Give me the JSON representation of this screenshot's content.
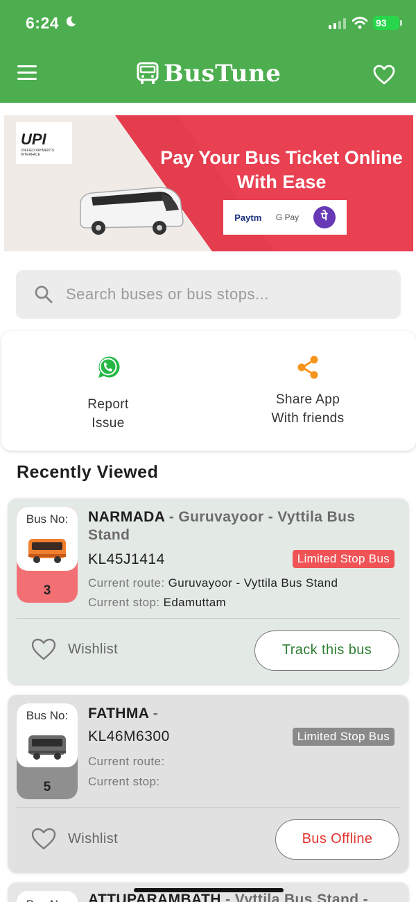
{
  "status_bar": {
    "time": "6:24",
    "battery": "93"
  },
  "header": {
    "title": "BusTune",
    "menu_icon": "hamburger-menu-icon",
    "favorites_icon": "heart-outline-icon"
  },
  "banner": {
    "upi_logo": "UPI",
    "upi_tagline": "UNIFIED PAYMENTS INTERFACE",
    "heading_line1": "Pay Your Bus Ticket Online",
    "heading_line2": "With Ease",
    "payment_apps": [
      "Paytm",
      "G Pay",
      "पे"
    ]
  },
  "search": {
    "placeholder": "Search buses or bus stops..."
  },
  "actions": {
    "report_line1": "Report",
    "report_line2": "Issue",
    "share_line1": "Share App",
    "share_line2": "With friends"
  },
  "recently_viewed": {
    "title": "Recently Viewed",
    "busno_label": "Bus No:",
    "route_label": "Current route:",
    "stop_label": "Current stop:",
    "wishlist_label": "Wishlist",
    "buses": [
      {
        "number": "3",
        "name": "NARMADA",
        "route_suffix": " - Guruvayoor - Vyttila Bus Stand",
        "registration": "KL45J1414",
        "type": "Limited Stop Bus",
        "current_route": "Guruvayoor - Vyttila Bus Stand",
        "current_stop": "Edamuttam",
        "button": "Track this bus",
        "accent_color": "#f27074"
      },
      {
        "number": "5",
        "name": "FATHMA",
        "route_suffix": " -",
        "registration": "KL46M6300",
        "type": "Limited Stop Bus",
        "current_route": "",
        "current_stop": "",
        "button": "Bus Offline",
        "accent_color": "#8f8f8f"
      },
      {
        "busno_partial": "Bus No:",
        "name": "ATTUPARAMBATH",
        "route_suffix": " - Vyttila Bus Stand -"
      }
    ]
  },
  "colors": {
    "primary": "#4cae4f",
    "limited_badge_active": "#ef5356",
    "offline": "#e2332d"
  }
}
